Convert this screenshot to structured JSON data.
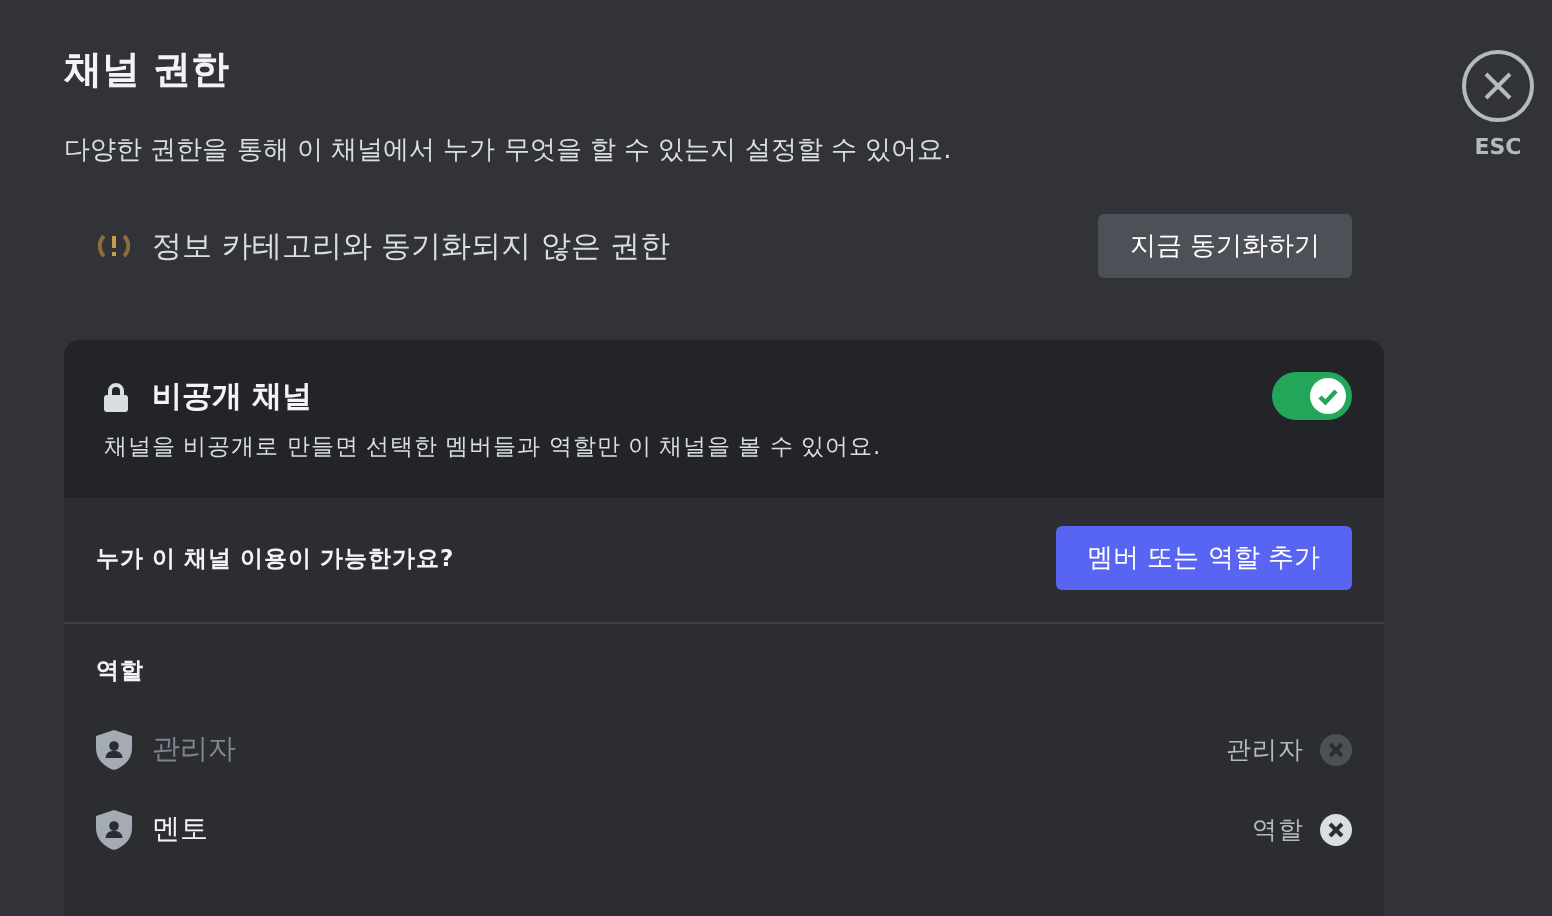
{
  "title": "채널 권한",
  "description": "다양한 권한을 통해 이 채널에서 누가 무엇을 할 수 있는지 설정할 수 있어요.",
  "close": {
    "label": "ESC"
  },
  "sync_notice": {
    "text": "정보 카테고리와 동기화되지 않은 권한",
    "button": "지금 동기화하기"
  },
  "private_channel": {
    "title": "비공개 채널",
    "on": true,
    "description": "채널을 비공개로 만들면 선택한 멤버들과 역할만 이 채널을 볼 수 있어요."
  },
  "access": {
    "question": "누가 이 채널 이용이 가능한가요?",
    "button": "멤버 또는 역할 추가"
  },
  "roles": {
    "heading": "역할",
    "items": [
      {
        "name": "관리자",
        "type": "관리자",
        "disabled": true
      },
      {
        "name": "멘토",
        "type": "역할",
        "disabled": false
      }
    ]
  }
}
